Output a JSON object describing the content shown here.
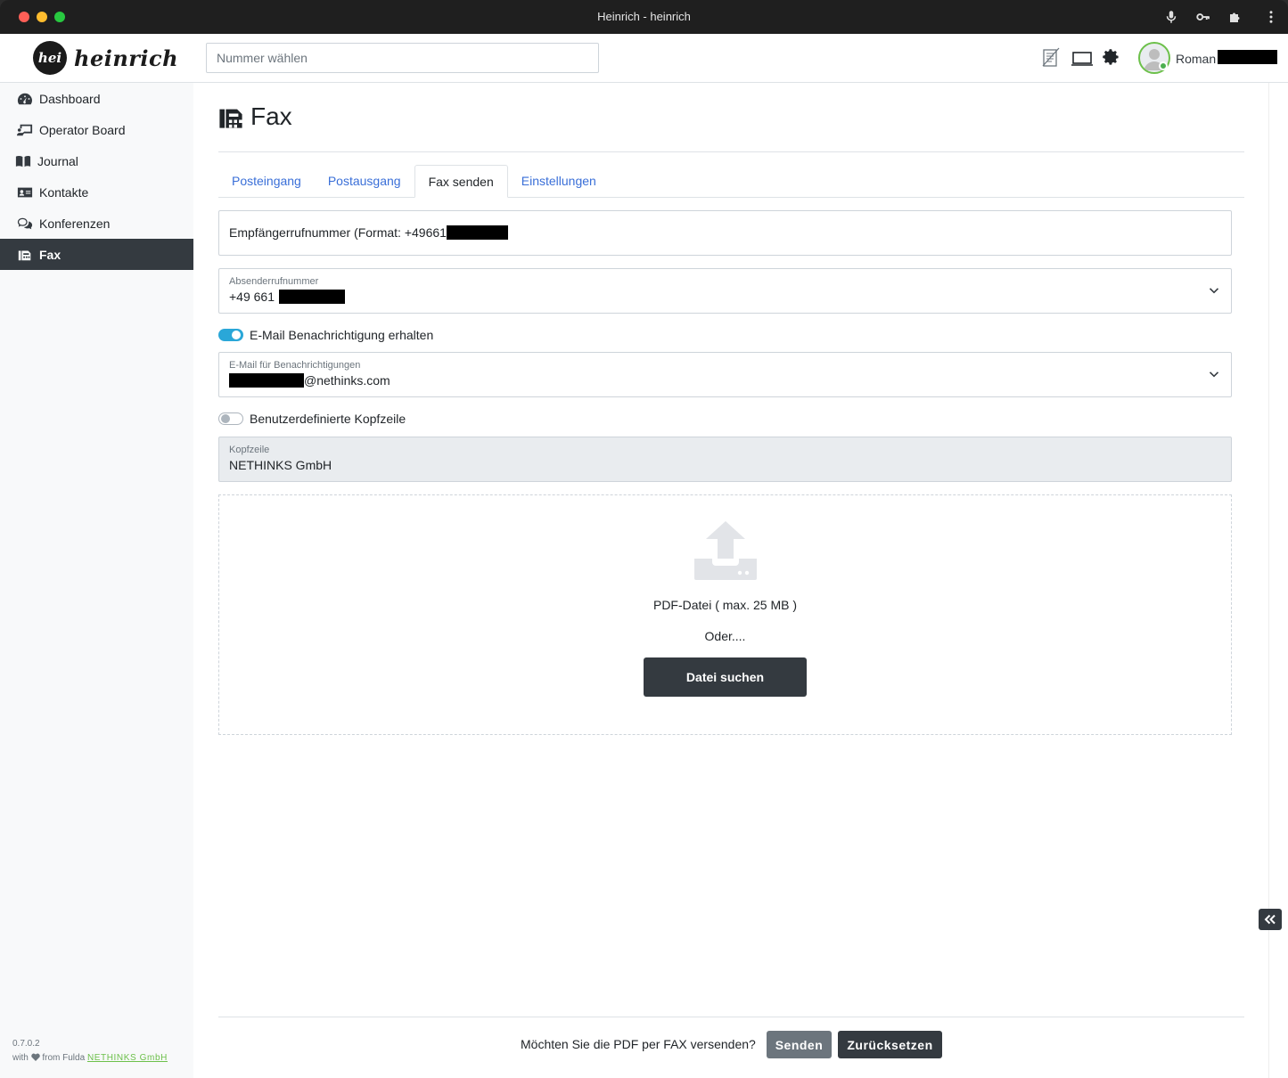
{
  "window": {
    "title": "Heinrich - heinrich"
  },
  "header": {
    "logo_badge": "hei",
    "logo_text": "heinrich",
    "dial_placeholder": "Nummer wählen",
    "user_name": "Roman"
  },
  "sidebar": {
    "items": [
      {
        "label": "Dashboard",
        "icon": "tachometer-icon"
      },
      {
        "label": "Operator Board",
        "icon": "operator-board-icon"
      },
      {
        "label": "Journal",
        "icon": "book-icon"
      },
      {
        "label": "Kontakte",
        "icon": "address-card-icon"
      },
      {
        "label": "Konferenzen",
        "icon": "comments-icon"
      },
      {
        "label": "Fax",
        "icon": "fax-icon",
        "active": true
      }
    ],
    "version": "0.7.0.2",
    "credit_prefix": "with",
    "credit_middle": "from Fulda",
    "credit_link": "NETHINKS GmbH"
  },
  "main": {
    "title": "Fax",
    "tabs": [
      {
        "label": "Posteingang"
      },
      {
        "label": "Postausgang"
      },
      {
        "label": "Fax senden",
        "active": true
      },
      {
        "label": "Einstellungen"
      }
    ],
    "recipient_placeholder": "Empfängerrufnummer (Format: +49661",
    "sender": {
      "label": "Absenderrufnummer",
      "value": "+49 661"
    },
    "email_toggle": {
      "label": "E-Mail Benachrichtigung erhalten",
      "on": true
    },
    "email_field": {
      "label": "E-Mail für Benachrichtigungen",
      "value": "@nethinks.com"
    },
    "header_toggle": {
      "label": "Benutzerdefinierte Kopfzeile",
      "on": false
    },
    "header_field": {
      "label": "Kopfzeile",
      "value": "NETHINKS GmbH"
    },
    "dropzone": {
      "pdf_label": "PDF-Datei ( max. 25 MB )",
      "or_label": "Oder....",
      "button": "Datei suchen"
    },
    "footer": {
      "question": "Möchten Sie die PDF per FAX versenden?",
      "send": "Senden",
      "reset": "Zurücksetzen"
    }
  },
  "colors": {
    "accent_dark": "#343a40",
    "link": "#3a6fd8",
    "toggle_on": "#2aa7d8",
    "online": "#4caf50",
    "brand_green": "#6cc04a"
  }
}
